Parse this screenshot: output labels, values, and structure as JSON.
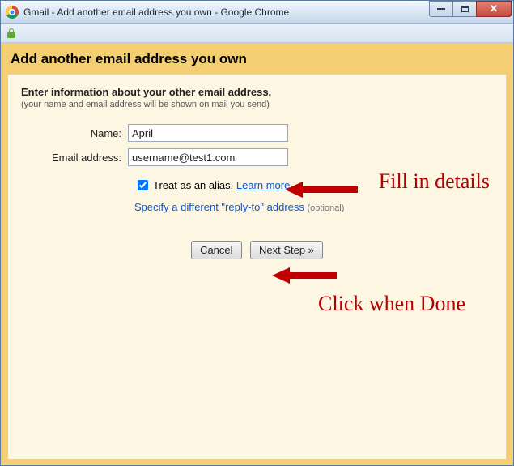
{
  "window": {
    "title": "Gmail - Add another email address you own - Google Chrome"
  },
  "header": {
    "title": "Add another email address you own"
  },
  "intro": {
    "line1": "Enter information about your other email address.",
    "line2": "(your name and email address will be shown on mail you send)"
  },
  "form": {
    "name_label": "Name:",
    "name_value": "April",
    "email_label": "Email address:",
    "email_value": "username@test1.com",
    "alias_label": "Treat as an alias.",
    "learn_more": "Learn more",
    "reply_to_link": "Specify a different \"reply-to\" address",
    "optional_text": "(optional)"
  },
  "buttons": {
    "cancel": "Cancel",
    "next": "Next Step »"
  },
  "annotations": {
    "fill": "Fill in details",
    "click": "Click when Done"
  }
}
